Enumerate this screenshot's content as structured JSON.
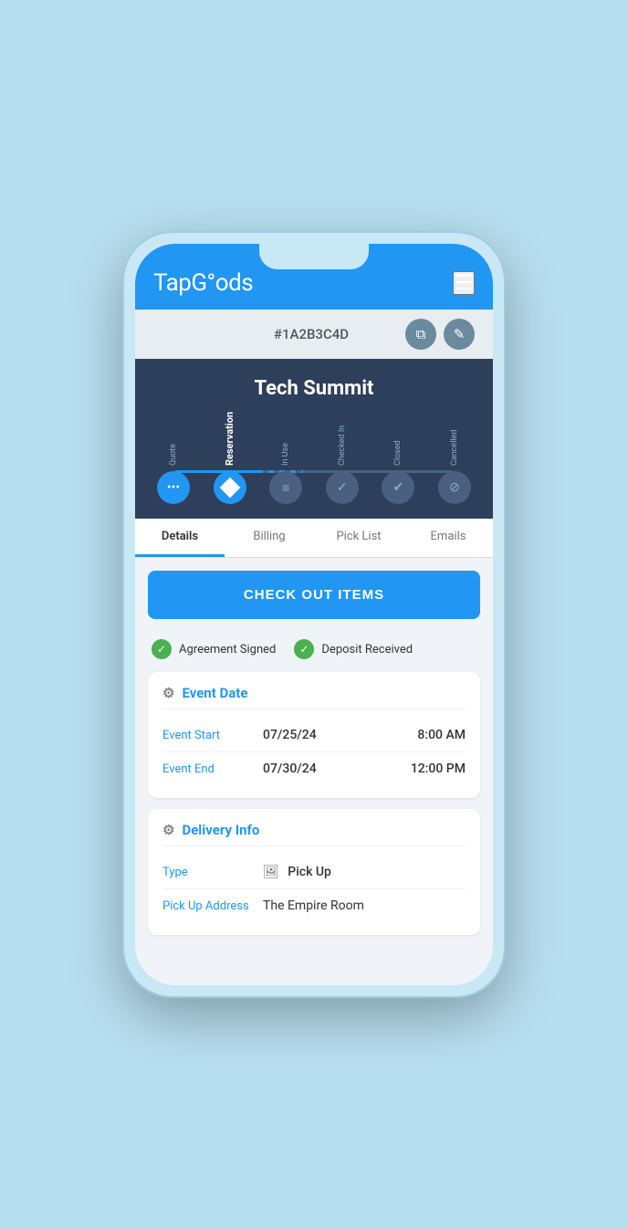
{
  "app": {
    "name": "TapGoods",
    "logo": "TapG°ods"
  },
  "header": {
    "reservation_id": "#1A2B3C4D",
    "copy_icon": "⧉",
    "edit_icon": "✎"
  },
  "event": {
    "title": "Tech Summit"
  },
  "stepper": {
    "steps": [
      {
        "label": "Quote",
        "state": "past"
      },
      {
        "label": "Reservation",
        "state": "active"
      },
      {
        "label": "In Use",
        "state": "future"
      },
      {
        "label": "Checked In",
        "state": "future"
      },
      {
        "label": "Closed",
        "state": "future"
      },
      {
        "label": "Cancelled",
        "state": "future"
      }
    ]
  },
  "tabs": [
    {
      "label": "Details",
      "active": true
    },
    {
      "label": "Billing",
      "active": false
    },
    {
      "label": "Pick List",
      "active": false
    },
    {
      "label": "Emails",
      "active": false
    }
  ],
  "checkout_button": "CHECK OUT ITEMS",
  "status_items": [
    {
      "label": "Agreement Signed",
      "checked": true
    },
    {
      "label": "Deposit Received",
      "checked": true
    }
  ],
  "event_date": {
    "title": "Event Date",
    "start_label": "Event Start",
    "start_date": "07/25/24",
    "start_time": "8:00 AM",
    "end_label": "Event End",
    "end_date": "07/30/24",
    "end_time": "12:00 PM"
  },
  "delivery_info": {
    "title": "Delivery Info",
    "type_label": "Type",
    "type_value": "Pick Up",
    "address_label": "Pick Up Address",
    "address_value": "The Empire Room"
  }
}
